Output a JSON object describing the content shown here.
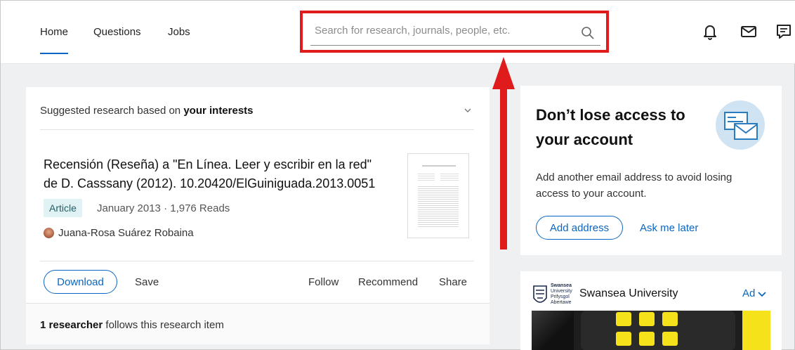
{
  "nav": {
    "home": "Home",
    "questions": "Questions",
    "jobs": "Jobs"
  },
  "search": {
    "placeholder": "Search for research, journals, people, etc."
  },
  "suggested": {
    "heading_prefix": "Suggested research based on ",
    "heading_bold": "your interests",
    "title_line1": "Recensión (Reseña) a \"En Línea. Leer y escribir en la red\"",
    "title_line2": "de D. Casssany (2012). 10.20420/ElGuiniguada.2013.0051",
    "type_badge": "Article",
    "meta": "January 2013 · 1,976 Reads",
    "author": "Juana-Rosa Suárez Robaina",
    "download_label": "Download",
    "save_label": "Save",
    "follow_label": "Follow",
    "recommend_label": "Recommend",
    "share_label": "Share",
    "followers_bold": "1 researcher",
    "followers_rest": " follows this research item"
  },
  "account_card": {
    "title_line1": "Don’t lose access to",
    "title_line2": "your account",
    "body_line1": "Add another email address to avoid losing",
    "body_line2": "access to your account.",
    "add_label": "Add address",
    "later_label": "Ask me later"
  },
  "ad": {
    "logo_text_1": "Swansea",
    "logo_text_2": "University",
    "logo_text_3": "Prifysgol",
    "logo_text_4": "Abertawe",
    "name": "Swansea University",
    "ad_label": "Ad"
  },
  "colors": {
    "accent": "#0a66c2",
    "highlight": "#e01b1b",
    "ad_yellow": "#f5e21a"
  }
}
